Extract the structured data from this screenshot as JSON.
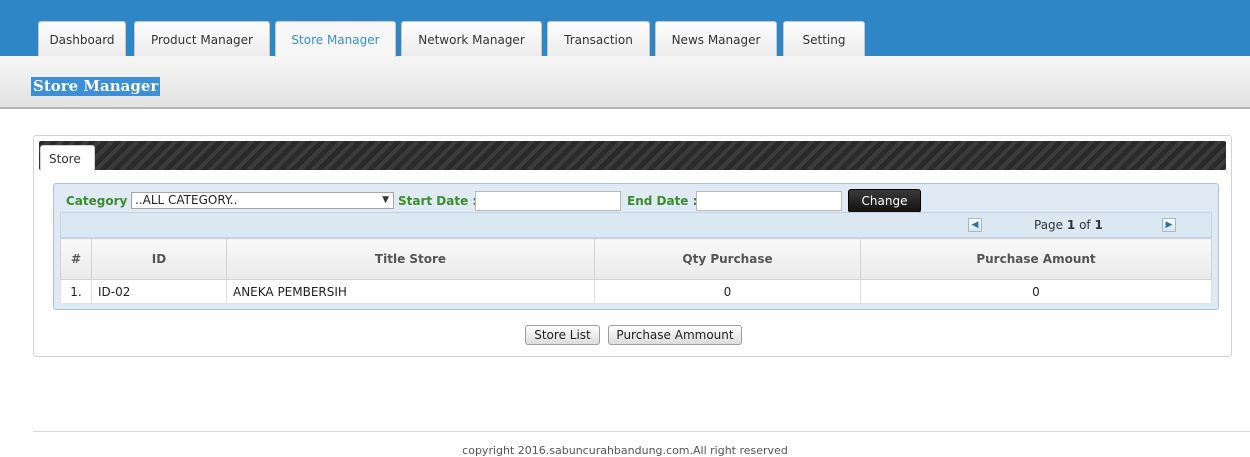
{
  "nav": {
    "tabs": [
      {
        "label": "Dashboard"
      },
      {
        "label": "Product Manager"
      },
      {
        "label": "Store Manager",
        "active": true
      },
      {
        "label": "Network Manager"
      },
      {
        "label": "Transaction"
      },
      {
        "label": "News Manager"
      },
      {
        "label": "Setting"
      }
    ]
  },
  "page": {
    "title": "Store Manager"
  },
  "panel": {
    "tab_label": "Store"
  },
  "filters": {
    "category_label": "Category",
    "category_value": "..ALL CATEGORY..",
    "start_date_label": "Start Date :",
    "start_date_value": "",
    "end_date_label": "End Date :",
    "end_date_value": "",
    "change_button": "Change"
  },
  "pager": {
    "prefix": "Page",
    "current": "1",
    "of_label": "of",
    "total": "1"
  },
  "table": {
    "columns": [
      "#",
      "ID",
      "Title Store",
      "Qty Purchase",
      "Purchase Amount"
    ],
    "rows": [
      {
        "num": "1.",
        "id": "ID-02",
        "title": "ANEKA PEMBERSIH",
        "qty": "0",
        "amount": "0"
      }
    ]
  },
  "actions": {
    "store_list": "Store List",
    "purchase_amount": "Purchase Ammount"
  },
  "footer": {
    "copyright": "copyright 2016.sabuncurahbandung.com.All right reserved"
  },
  "colors": {
    "header_blue": "#2f86c6",
    "label_green": "#3c8c2e",
    "active_tab": "#3b8ed0"
  }
}
